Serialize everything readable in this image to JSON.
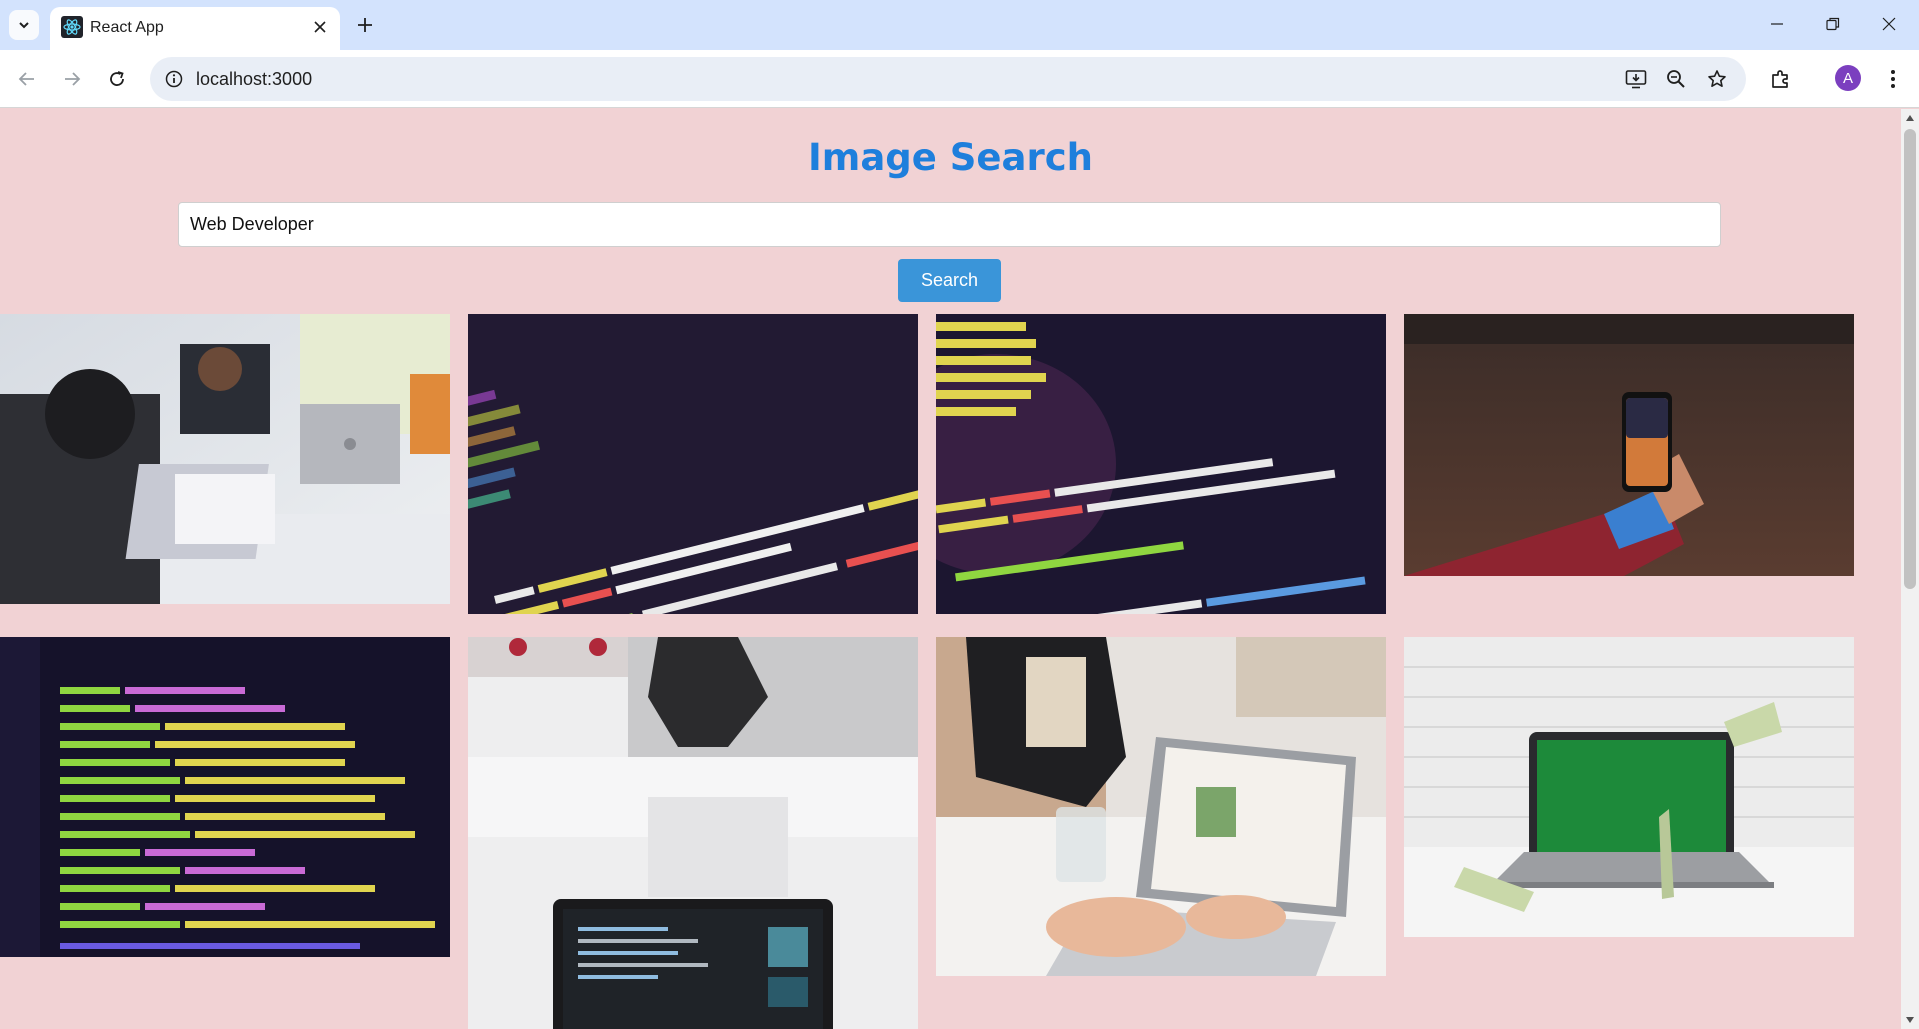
{
  "browser": {
    "tab_title": "React App",
    "url": "localhost:3000",
    "profile_initial": "A",
    "icons": {
      "tab_search": "chevron-down-icon",
      "favicon": "react-logo-icon",
      "tab_close": "close-icon",
      "new_tab": "plus-icon",
      "minimize": "minimize-icon",
      "restore": "restore-icon",
      "close_window": "close-icon",
      "back": "back-arrow-icon",
      "forward": "forward-arrow-icon",
      "reload": "reload-icon",
      "site_info": "info-icon",
      "install": "install-app-icon",
      "zoom": "zoom-icon",
      "bookmark": "star-icon",
      "extensions": "puzzle-icon",
      "menu": "kebab-menu-icon"
    }
  },
  "page": {
    "title": "Image Search",
    "search": {
      "value": "Web Developer",
      "button_label": "Search"
    },
    "results": [
      {
        "subject": "developers-working-on-laptops"
      },
      {
        "subject": "code-authentication-failed-dark"
      },
      {
        "subject": "code-css-login-form"
      },
      {
        "subject": "hand-holding-smartphone"
      },
      {
        "subject": "webpack-config-code"
      },
      {
        "subject": "laptop-on-white-desk-with-code"
      },
      {
        "subject": "person-typing-on-laptop"
      },
      {
        "subject": "laptop-green-screen-with-money"
      }
    ]
  },
  "colors": {
    "page_bg": "#f1d2d4",
    "title": "#1e7fdc",
    "button": "#3a95d9",
    "chrome_tabbar": "#d3e3fd"
  }
}
